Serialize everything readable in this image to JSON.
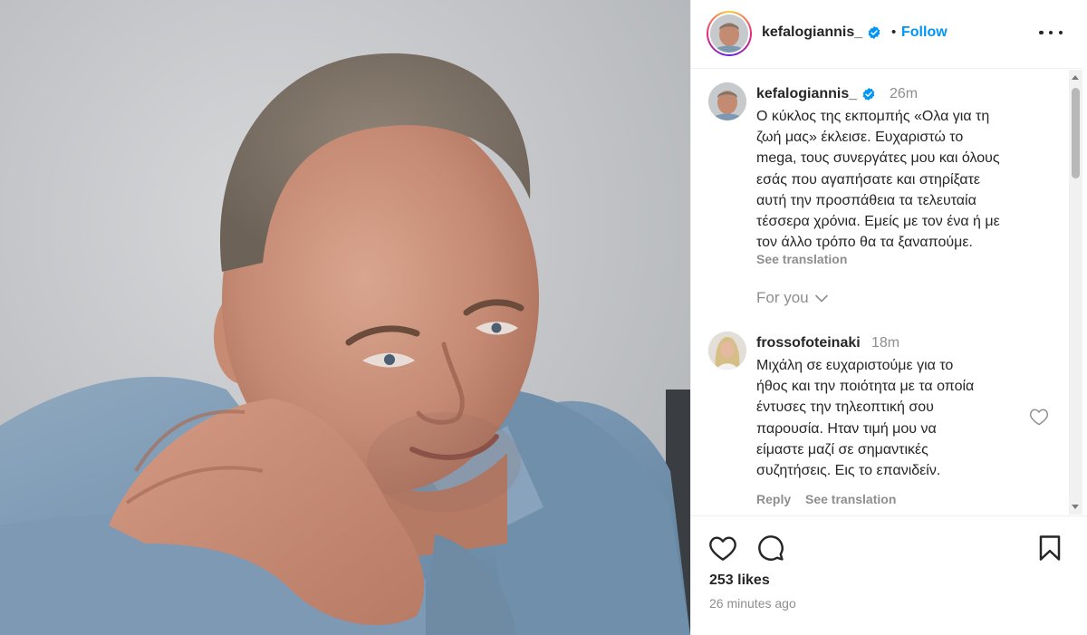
{
  "post": {
    "author": "kefalogiannis_",
    "follow_label": "Follow",
    "separator": "•",
    "verified": true,
    "likes": "253 likes",
    "posted_ago": "26 minutes ago"
  },
  "caption": {
    "username": "kefalogiannis_",
    "time": "26m",
    "text": "Ο κύκλος της εκπομπής «Ολα για τη\nζωή μας» έκλεισε.  Ευχαριστώ  το\nmega, τους συνεργάτες μου και όλους\nεσάς που αγαπήσατε και στηρίξατε\nαυτή την προσπάθεια τα τελευταία\nτέσσερα χρόνια. Εμείς με τον ένα ή με\nτον άλλο τρόπο θα τα ξαναπούμε.",
    "see_translation": "See translation"
  },
  "filter": {
    "label": "For you"
  },
  "comments": [
    {
      "username": "frossofoteinaki",
      "time": "18m",
      "text": "Μιχάλη σε ευχαριστούμε για το\nήθος και την ποιότητα με τα οποία\nέντυσες την τηλεοπτική σου\nπαρουσία. Ηταν τιμή μου να\nείμαστε μαζί σε σημαντικές\nσυζητήσεις. Εις το επανιδείν.",
      "reply_label": "Reply",
      "see_translation": "See translation"
    }
  ],
  "icons": {
    "more": "more-options-icon",
    "verified": "verified-badge-icon",
    "like": "heart-icon",
    "comment": "comment-icon",
    "save": "bookmark-icon",
    "chevron": "chevron-down-icon"
  },
  "colors": {
    "accent": "#0095f6",
    "verified": "#0095f6",
    "text": "#262626",
    "muted": "#8e8e8e"
  }
}
